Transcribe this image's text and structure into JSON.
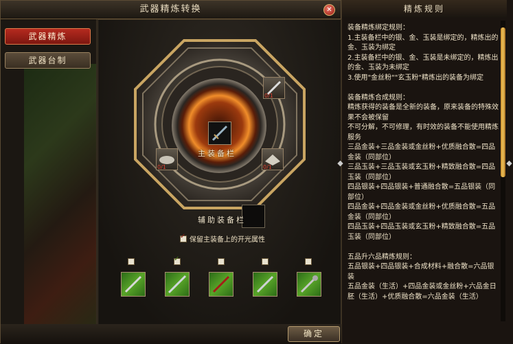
{
  "window": {
    "title": "武器精炼转换",
    "close_label": "✕"
  },
  "tabs": [
    {
      "label": "武器精炼"
    },
    {
      "label": "武器台制"
    }
  ],
  "refine": {
    "main_slot_label": "主装备栏",
    "aux_slot_label": "辅助装备栏",
    "keep_option_label": "保留主装备上的开光属性",
    "keep_option_checked": true,
    "counts": {
      "top_right": "0/1",
      "left": "0/1",
      "right": "0/1"
    }
  },
  "materials": [
    {
      "checked": false
    },
    {
      "checked": true
    },
    {
      "checked": false
    },
    {
      "checked": false
    },
    {
      "checked": false
    }
  ],
  "confirm_label": "确定",
  "rules": {
    "title": "精炼规则",
    "text": "装备精炼绑定规则：\n1.主装备栏中的银、金、玉装是绑定的，精炼出的金、玉装为绑定\n2.主装备栏中的银、金、玉装是未绑定的，精炼出的金、玉装为未绑定\n3.使用\"金丝粉\"\"玄玉粉\"精炼出的装备为绑定\n\n装备精炼合成规则：\n精炼获得的装备是全新的装备，原来装备的特殊效果不会被保留\n不可分解，不可修理，有时效的装备不能使用精炼服务\n三品金装+三品金装或金丝粉+优质融合散=四品金装（同部位）\n三品玉装+三品玉装或玄玉粉+精致融合散=四品玉装（同部位）\n四品银装+四品银装+普通融合散=五品银装（同部位）\n四品金装+四品金装或金丝粉+优质融合散=五品金装（同部位）\n四品玉装+四品玉装或玄玉粉+精致融合散=五品玉装（同部位）\n\n五品升六品精炼规则：\n五品银装+四品银装+合成材料+融合散=六品银装\n五品金装（生活）+四品金装或金丝粉+六品金日胚（生活）+优质融合散=六品金装（生活）"
  },
  "colors": {
    "accent_red": "#b52a1f",
    "gold": "#c9a562",
    "scroll": "#f0c25a"
  }
}
